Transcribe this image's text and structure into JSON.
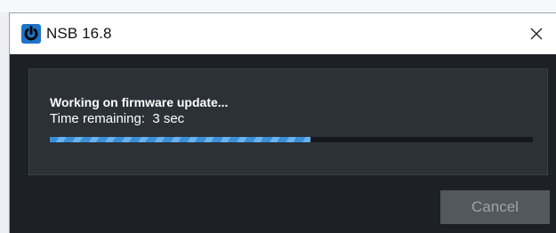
{
  "window": {
    "title": "NSB 16.8",
    "app_icon": "nsb-power-icon",
    "close_glyph": "✕",
    "close_icon": "close-icon"
  },
  "status": {
    "title": "Working on firmware update...",
    "time_label": "Time remaining:",
    "time_value": "3 sec",
    "progress": 0.54
  },
  "actions": {
    "cancel_label": "Cancel",
    "cancel_enabled": false
  },
  "colors": {
    "accent": "#3a8fd6",
    "dialog_bg": "#1d2126",
    "panel_bg": "#2c3137"
  }
}
